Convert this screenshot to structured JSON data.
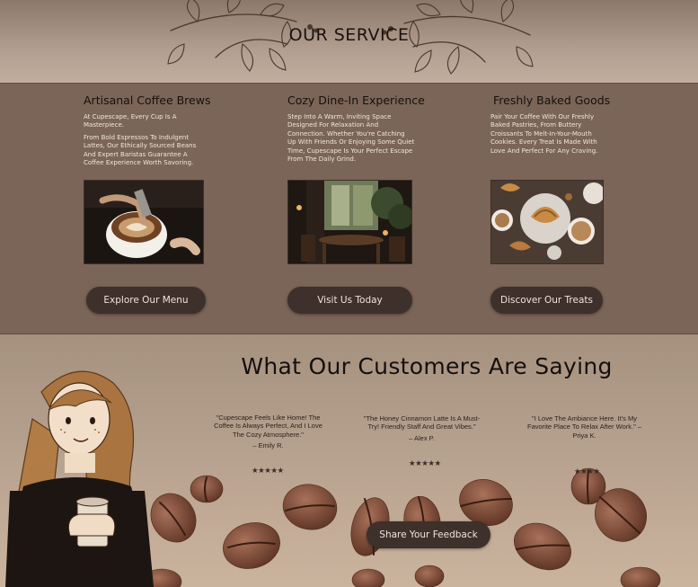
{
  "service": {
    "title": "OUR SERVICE",
    "cards": [
      {
        "title": "Artisanal Coffee Brews",
        "paragraphs": [
          "At Cupescape, Every Cup Is A Masterpiece.",
          "From Bold Espressos To Indulgent Lattes, Our Ethically Sourced Beans And Expert Baristas Guarantee A Coffee Experience Worth Savoring."
        ],
        "button": "Explore Our Menu",
        "image": "latte-art-pour-photo"
      },
      {
        "title": "Cozy Dine-In Experience",
        "paragraphs": [
          "Step Into A Warm, Inviting Space Designed For Relaxation And Connection. Whether You're Catching Up With Friends Or Enjoying Some Quiet Time, Cupescape Is Your Perfect Escape From The Daily Grind."
        ],
        "button": "Visit Us Today",
        "image": "cafe-interior-photo"
      },
      {
        "title": "Freshly Baked Goods",
        "paragraphs": [
          "Pair Your Coffee With Our Freshly Baked Pastries, From Buttery Croissants To Melt-In-Your-Mouth Cookies. Every Treat Is Made With Love And Perfect For Any Craving."
        ],
        "button": "Discover Our Treats",
        "image": "pastries-table-photo"
      }
    ]
  },
  "testimonials": {
    "title": "What Our Customers Are Saying",
    "reviews": [
      {
        "quote": "\"Cupescape Feels Like Home! The Coffee Is Always Perfect, And I Love The Cozy Atmosphere.\"",
        "author": "– Emily R.",
        "stars": "★★★★★",
        "rating": 5
      },
      {
        "quote": "\"The Honey Cinnamon Latte Is A Must-Try! Friendly Staff And Great Vibes.\"",
        "author": "– Alex P.",
        "stars": "★★★★★",
        "rating": 5
      },
      {
        "quote": "\"I Love The Ambiance Here. It's My Favorite Place To Relax After Work.\" – Priya K.",
        "author": "",
        "stars": "★★★★",
        "rating": 4
      }
    ],
    "button": "Share Your Feedback"
  },
  "colors": {
    "panel": "#7a6558",
    "button": "#3e302a",
    "button_text": "#efe4db",
    "heading": "#17100d"
  }
}
